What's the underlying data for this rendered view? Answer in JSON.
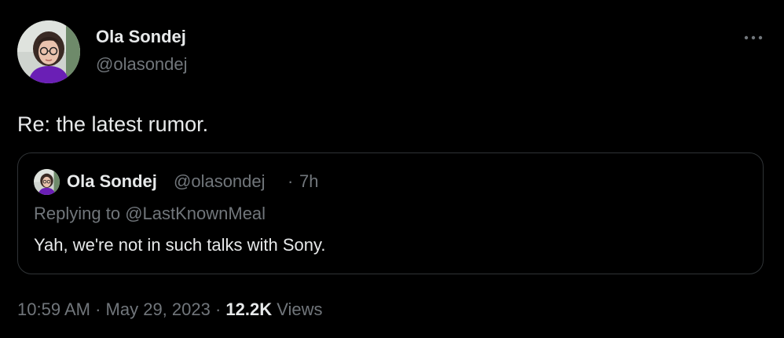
{
  "author": {
    "name": "Ola Sondej",
    "handle": "@olasondej",
    "avatar_icon": "profile-photo"
  },
  "more_icon": "ellipsis-horizontal-icon",
  "tweet": {
    "text": "Re: the latest rumor."
  },
  "quoted_tweet": {
    "name": "Ola Sondej",
    "handle": "@olasondej",
    "separator": "·",
    "time": "7h",
    "replying_prefix": "Replying to ",
    "replying_mention": "@LastKnownMeal",
    "text": "Yah, we're not in such talks with Sony."
  },
  "meta": {
    "time": "10:59 AM",
    "date": "May 29, 2023",
    "separator": "·",
    "views_count": "12.2K",
    "views_label": "Views"
  },
  "colors": {
    "background": "#000000",
    "text_primary": "#e7e9ea",
    "text_secondary": "#71767b",
    "border": "#2f3336",
    "avatar_shirt": "#6a1fb5"
  }
}
